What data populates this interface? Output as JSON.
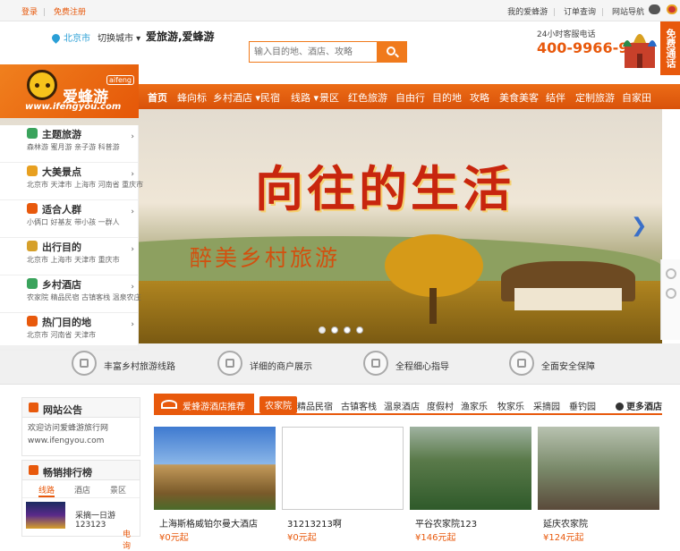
{
  "topbar": {
    "login": "登录",
    "register": "免费注册",
    "my": "我的爱蜂游",
    "orders": "订单查询",
    "sitenav": "网站导航",
    "sep": "|"
  },
  "header": {
    "city": "北京市",
    "switch_city": "切换城市 ▾",
    "slogan": "爱旅游,爱蜂游",
    "search_placeholder": "输入目的地、酒店、攻略",
    "hotline_label": "24小时客服电话",
    "hotline": "400-9966-900",
    "free_call": "免费通话"
  },
  "logo": {
    "name": "爱蜂游",
    "tag": "aifeng",
    "url": "www.ifengyou.com"
  },
  "nav": [
    {
      "label": "首页",
      "active": true
    },
    {
      "label": "蜂向标"
    },
    {
      "label": "乡村酒店 ▾"
    },
    {
      "label": "民宿"
    },
    {
      "label": "线路 ▾"
    },
    {
      "label": "景区"
    },
    {
      "label": "红色旅游"
    },
    {
      "label": "自由行"
    },
    {
      "label": "目的地"
    },
    {
      "label": "攻略"
    },
    {
      "label": "美食美客"
    },
    {
      "label": "结伴"
    },
    {
      "label": "定制旅游"
    },
    {
      "label": "自家田"
    }
  ],
  "side": [
    {
      "title": "主题旅游",
      "sub": "森林游  蜜月游  亲子游  科普游",
      "color": "#3aa35c"
    },
    {
      "title": "大美景点",
      "sub": "北京市  天津市  上海市  河南省  重庆市",
      "color": "#e8a020"
    },
    {
      "title": "适合人群",
      "sub": "小俩口  好基友  带小孩  一群人",
      "color": "#e8590c"
    },
    {
      "title": "出行目的",
      "sub": "北京市  上海市  天津市  重庆市",
      "color": "#d6a02a"
    },
    {
      "title": "乡村酒店",
      "sub": "农家院  精品民宿  古镇客栈  温泉农庄",
      "color": "#3aa35c"
    },
    {
      "title": "热门目的地",
      "sub": "北京市  河南省  天津市",
      "color": "#e8590c"
    }
  ],
  "banner": {
    "title": "向往的生活",
    "subtitle": "醉美乡村旅游",
    "next": "❯"
  },
  "features": [
    "丰富乡村旅游线路",
    "详细的商户展示",
    "全程细心指导",
    "全面安全保障"
  ],
  "notice": {
    "title": "网站公告",
    "line1": "欢迎访问爱蜂游旅行网",
    "line2": "www.ifengyou.com"
  },
  "rank": {
    "title": "畅销排行榜",
    "tabs": [
      "线路",
      "酒店",
      "景区"
    ],
    "item": "采摘一日游123123",
    "price": "电询"
  },
  "hotels": {
    "title": "爱蜂游酒店推荐",
    "tabs": [
      "农家院",
      "精品民宿",
      "古镇客栈",
      "温泉酒店",
      "度假村",
      "渔家乐",
      "牧家乐",
      "采摘园",
      "垂钓园"
    ],
    "more": "更多酒店",
    "cards": [
      {
        "name": "上海斯格威铂尔曼大酒店",
        "price": "¥0元起"
      },
      {
        "name": "31213213啊",
        "price": "¥0元起"
      },
      {
        "name": "平谷农家院123",
        "price": "¥146元起"
      },
      {
        "name": "延庆农家院",
        "price": "¥124元起"
      }
    ]
  }
}
